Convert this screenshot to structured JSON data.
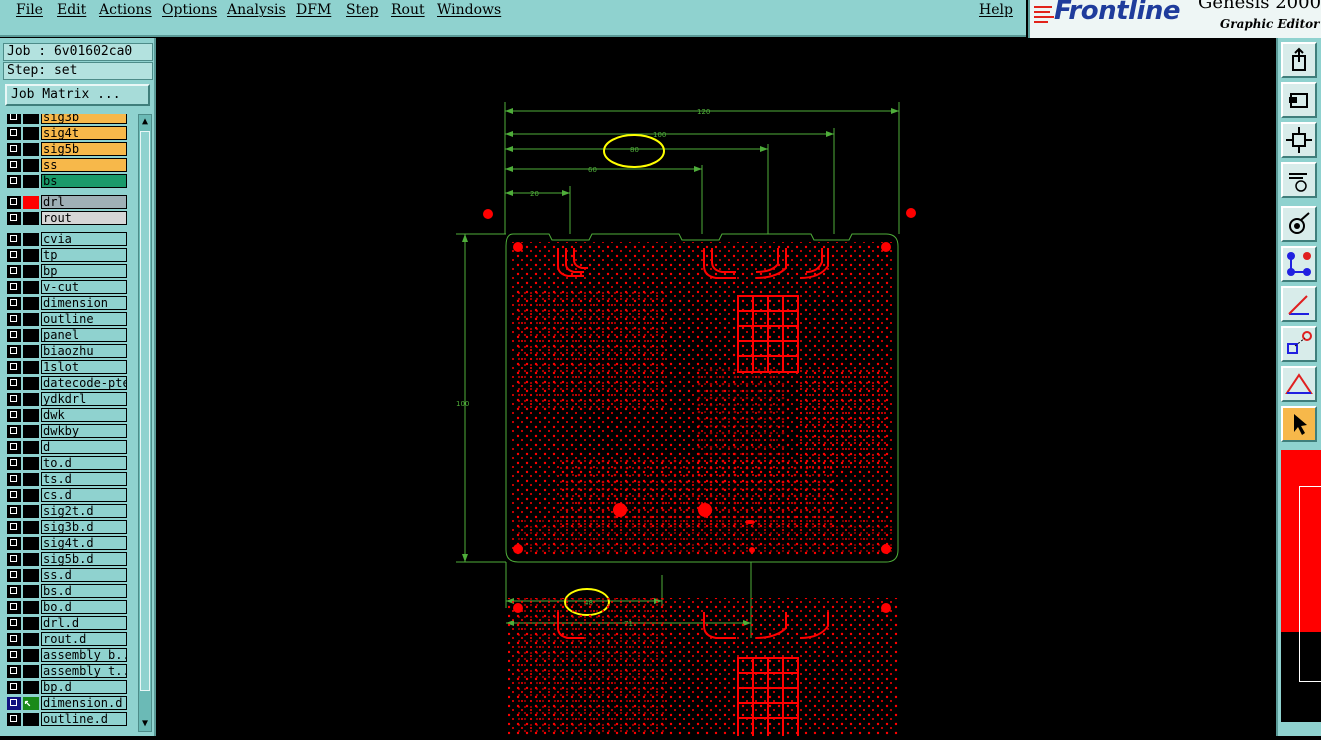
{
  "menu": [
    {
      "name": "file",
      "label": "File"
    },
    {
      "name": "edit",
      "label": "Edit"
    },
    {
      "name": "actions",
      "label": "Actions"
    },
    {
      "name": "options",
      "label": "Options"
    },
    {
      "name": "analysis",
      "label": "Analysis"
    },
    {
      "name": "dfm",
      "label": "DFM"
    },
    {
      "name": "step",
      "label": "Step"
    },
    {
      "name": "rout",
      "label": "Rout"
    },
    {
      "name": "windows",
      "label": "Windows"
    },
    {
      "name": "help",
      "label": "Help"
    }
  ],
  "logo": {
    "name": "Frontline",
    "product": "Genesis 2000",
    "subtitle": "Graphic Editor"
  },
  "job": {
    "label": "Job : 6v01602ca0",
    "step": "Step: set",
    "matrix_button": "Job Matrix ..."
  },
  "layers": [
    {
      "name": "sig3b",
      "color": "#f7b84a"
    },
    {
      "name": "sig4t",
      "color": "#f7b84a"
    },
    {
      "name": "sig5b",
      "color": "#f7b84a"
    },
    {
      "name": "ss",
      "color": "#f7b84a"
    },
    {
      "name": "bs",
      "color": "#1a9a6a",
      "mark": "black"
    },
    {
      "name": "drl",
      "color": "#9fb0b6",
      "mark": "red",
      "gap": true
    },
    {
      "name": "rout",
      "color": "#d6d6d6"
    },
    {
      "name": "cvia",
      "gap": true
    },
    {
      "name": "tp"
    },
    {
      "name": "bp"
    },
    {
      "name": "v-cut"
    },
    {
      "name": "dimension"
    },
    {
      "name": "outline"
    },
    {
      "name": "panel"
    },
    {
      "name": "biaozhu"
    },
    {
      "name": "1slot"
    },
    {
      "name": "datecode-pte"
    },
    {
      "name": "ydkdrl"
    },
    {
      "name": "dwk"
    },
    {
      "name": "dwkby"
    },
    {
      "name": "d"
    },
    {
      "name": "to.d"
    },
    {
      "name": "ts.d"
    },
    {
      "name": "cs.d"
    },
    {
      "name": "sig2t.d"
    },
    {
      "name": "sig3b.d"
    },
    {
      "name": "sig4t.d"
    },
    {
      "name": "sig5b.d"
    },
    {
      "name": "ss.d"
    },
    {
      "name": "bs.d"
    },
    {
      "name": "bo.d"
    },
    {
      "name": "drl.d"
    },
    {
      "name": "rout.d"
    },
    {
      "name": "assembly_b..."
    },
    {
      "name": "assembly_t..."
    },
    {
      "name": "bp.d"
    },
    {
      "name": "dimension.d",
      "mark": "green",
      "selected": true
    },
    {
      "name": "outline.d"
    }
  ],
  "dimensions": {
    "top_120": "120",
    "top_100": "100",
    "top_80": "80",
    "top_60": "60",
    "top_20": "20",
    "left_100": "100",
    "bottom_48": "48",
    "bottom_71": "71"
  },
  "colors": {
    "panel": "#8fd2cf",
    "board": "#ff0000",
    "dimension": "#4fae3a",
    "highlight": "#ffff00",
    "canvas": "#000000"
  },
  "toolbar": [
    {
      "name": "zoom-home-icon"
    },
    {
      "name": "zoom-back-icon"
    },
    {
      "name": "zoom-fit-icon"
    },
    {
      "name": "measure-tools-icon"
    },
    {
      "name": "feature-select-icon"
    },
    {
      "name": "connect-nodes-icon"
    },
    {
      "name": "angle-measure-icon"
    },
    {
      "name": "snap-icon"
    },
    {
      "name": "drc-warning-icon"
    },
    {
      "name": "pointer-icon"
    }
  ]
}
